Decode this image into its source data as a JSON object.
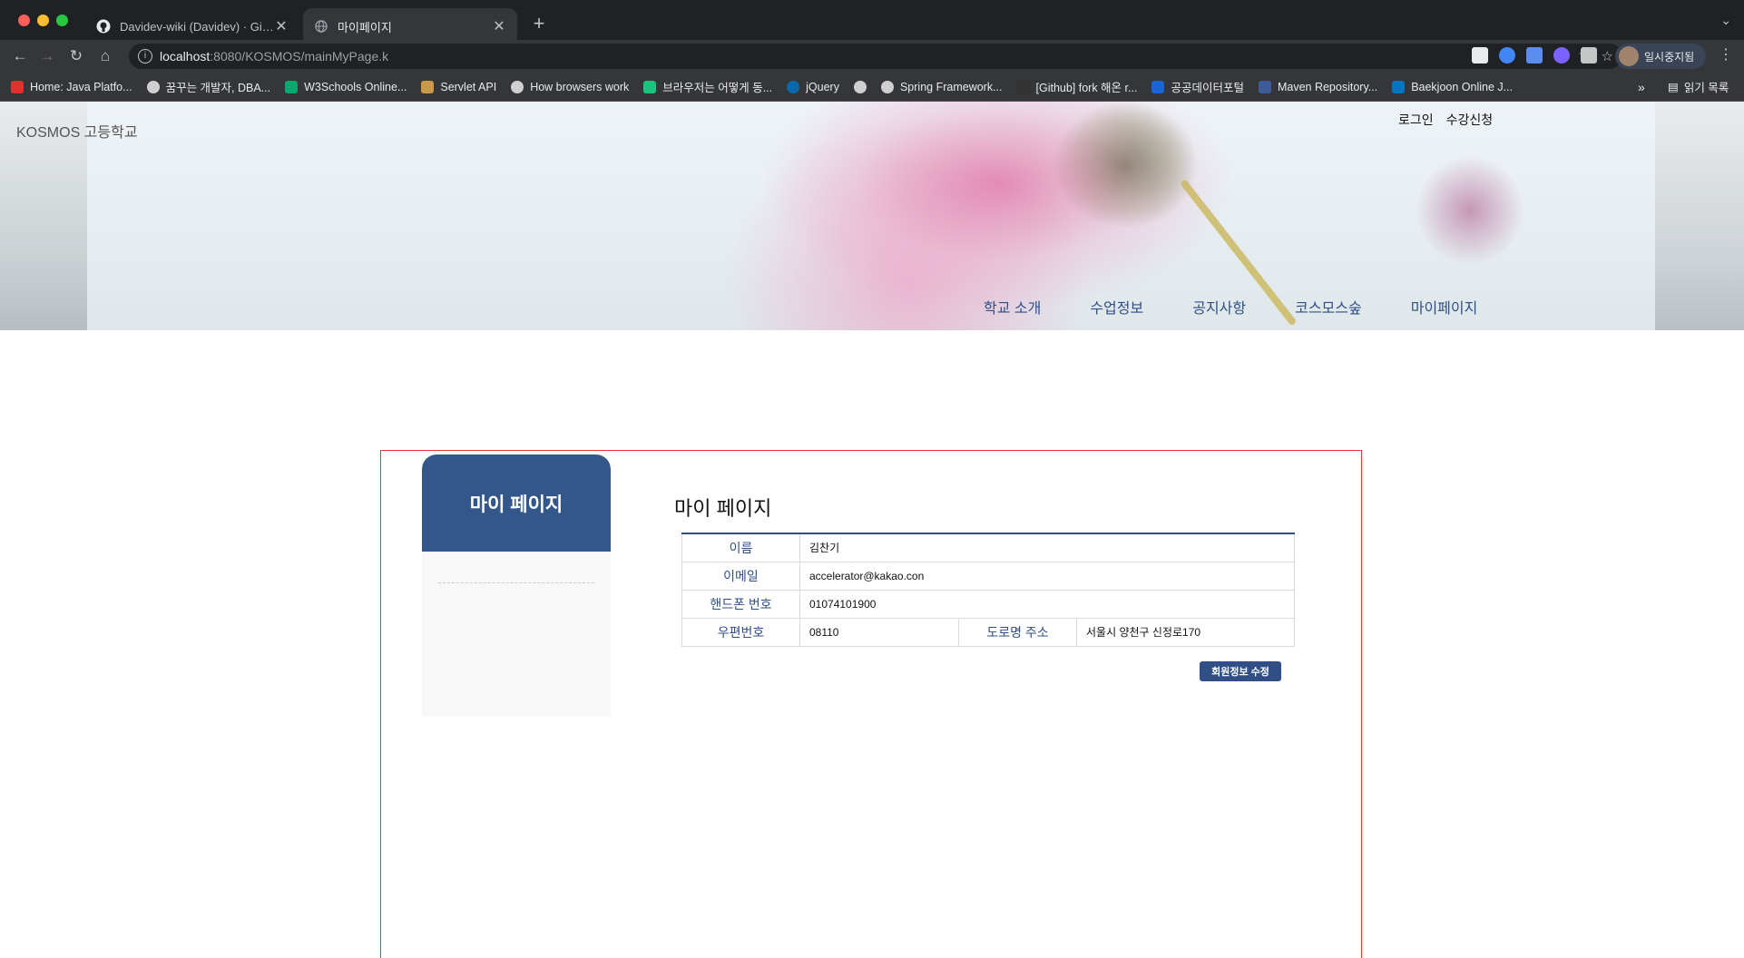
{
  "browser": {
    "tabs": [
      {
        "title": "Davidev-wiki (Davidev) · GitHub",
        "active": false
      },
      {
        "title": "마이페이지",
        "active": true
      }
    ],
    "url_host": "localhost",
    "url_path": ":8080/KOSMOS/mainMyPage.k",
    "profile_label": "일시중지됨",
    "bookmarks": [
      {
        "label": "Home: Java Platfo...",
        "color": "#e0322d"
      },
      {
        "label": "꿈꾸는 개발자, DBA...",
        "color": "#cfcfcf"
      },
      {
        "label": "W3Schools Online...",
        "color": "#04aa6d"
      },
      {
        "label": "Servlet API",
        "color": "#c99a4e"
      },
      {
        "label": "How browsers work",
        "color": "#cfcfcf"
      },
      {
        "label": "브라우저는 어떻게 동...",
        "color": "#19c37d"
      },
      {
        "label": "jQuery",
        "color": "#0769ad"
      },
      {
        "label": "",
        "color": "#cfcfcf"
      },
      {
        "label": "Spring Framework...",
        "color": "#cfcfcf"
      },
      {
        "label": "[Github] fork 해온 r...",
        "color": "#333333"
      },
      {
        "label": "공공데이터포털",
        "color": "#1a63d6"
      },
      {
        "label": "Maven Repository...",
        "color": "#3d5a99"
      },
      {
        "label": "Baekjoon Online J...",
        "color": "#0076c0"
      }
    ],
    "more_label": "»",
    "reading_list_label": "읽기 목록"
  },
  "header": {
    "school_name": "KOSMOS 고등학교",
    "top_links": [
      "로그인",
      "수강신청"
    ],
    "nav": [
      "학교 소개",
      "수업정보",
      "공지사항",
      "코스모스숲",
      "마이페이지"
    ]
  },
  "sidebar": {
    "title": "마이 페이지"
  },
  "main": {
    "title": "마이 페이지",
    "fields": {
      "name_label": "이름",
      "name_value": "김찬기",
      "email_label": "이메일",
      "email_value": "accelerator@kakao.con",
      "phone_label": "핸드폰 번호",
      "phone_value": "01074101900",
      "zip_label": "우편번호",
      "zip_value": "08110",
      "addr_label": "도로명 주소",
      "addr_value": "서울시 양천구 신정로170"
    },
    "edit_button": "회원정보 수정"
  }
}
